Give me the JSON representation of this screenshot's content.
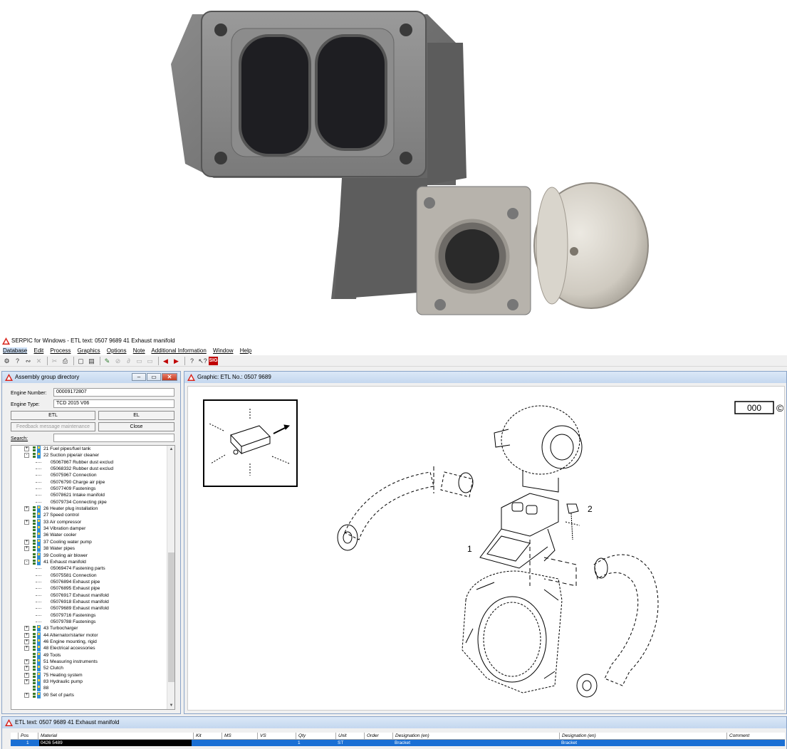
{
  "window": {
    "title": "SERPIC for Windows - ETL text: 0507 9689   41  Exhaust manifold"
  },
  "menu": [
    "Database",
    "Edit",
    "Process",
    "Graphics",
    "Options",
    "Note",
    "Additional Information",
    "Window",
    "Help"
  ],
  "toolbar_icons": [
    "engine-icon",
    "help-icon",
    "tool-icon",
    "close-icon",
    "cut-icon",
    "print-icon",
    "new-icon",
    "open-icon",
    "draw-icon",
    "link-icon",
    "link2-icon",
    "doc-icon",
    "doc2-icon",
    "back-arrow-icon",
    "forward-arrow-icon",
    "question-icon",
    "whats-this-icon",
    "sig-icon"
  ],
  "assembly": {
    "title": "Assembly group directory",
    "engine_number_label": "Engine Number:",
    "engine_number": "00009172807",
    "engine_type_label": "Engine Type:",
    "engine_type": "TCD 2015 V06",
    "etl_button": "ETL",
    "el_button": "EL",
    "feedback_button": "Feedback message maintenance",
    "close_button": "Close",
    "search_label": "Search:",
    "search_value": "",
    "tree": [
      {
        "type": "group",
        "label": "21  Fuel pipes/fuel tank",
        "expander": "+"
      },
      {
        "type": "group",
        "label": "22  Suction pipe/air cleaner",
        "expander": "-"
      },
      {
        "type": "child",
        "label": "05067867  Rubber dust exclud"
      },
      {
        "type": "child",
        "label": "05068332  Rubber dust exclud"
      },
      {
        "type": "child",
        "label": "05075967  Connection"
      },
      {
        "type": "child",
        "label": "05076790  Charge air pipe"
      },
      {
        "type": "child",
        "label": "05077409  Fastenings"
      },
      {
        "type": "child",
        "label": "05078621  Intake manifold"
      },
      {
        "type": "child",
        "label": "05079734  Connecting pipe"
      },
      {
        "type": "group",
        "label": "26  Heater plug installation",
        "expander": "+"
      },
      {
        "type": "group",
        "label": "27  Speed control",
        "expander": ""
      },
      {
        "type": "group",
        "label": "33  Air compressor",
        "expander": "+"
      },
      {
        "type": "group",
        "label": "34  Vibration damper",
        "expander": ""
      },
      {
        "type": "group",
        "label": "36  Water cooler",
        "expander": ""
      },
      {
        "type": "group",
        "label": "37  Cooling water pump",
        "expander": "+"
      },
      {
        "type": "group",
        "label": "38  Water pipes",
        "expander": "+"
      },
      {
        "type": "group",
        "label": "39  Cooling air blower",
        "expander": ""
      },
      {
        "type": "group",
        "label": "41  Exhaust manifold",
        "expander": "-"
      },
      {
        "type": "child",
        "label": "05069474  Fastening parts"
      },
      {
        "type": "child",
        "label": "05075581  Connection"
      },
      {
        "type": "child",
        "label": "05076894  Exhaust pipe"
      },
      {
        "type": "child",
        "label": "05076895  Exhaust pipe"
      },
      {
        "type": "child",
        "label": "05076917  Exhaust manifold"
      },
      {
        "type": "child",
        "label": "05076918  Exhaust manifold"
      },
      {
        "type": "child",
        "label": "05079689  Exhaust manifold"
      },
      {
        "type": "child",
        "label": "05079716  Fastenings"
      },
      {
        "type": "child",
        "label": "05079788  Fastenings"
      },
      {
        "type": "group",
        "label": "43  Turbocharger",
        "expander": "+"
      },
      {
        "type": "group",
        "label": "44  Alternator/starter motor",
        "expander": "+"
      },
      {
        "type": "group",
        "label": "46  Engine mounting, rigid",
        "expander": "+"
      },
      {
        "type": "group",
        "label": "48  Electrical accessories",
        "expander": "+"
      },
      {
        "type": "group",
        "label": "49  Tools",
        "expander": ""
      },
      {
        "type": "group",
        "label": "51  Measuring instruments",
        "expander": "+"
      },
      {
        "type": "group",
        "label": "52  Clutch",
        "expander": "+"
      },
      {
        "type": "group",
        "label": "75  Heating system",
        "expander": "+"
      },
      {
        "type": "group",
        "label": "83  Hydraulic pump",
        "expander": "+"
      },
      {
        "type": "group",
        "label": "88",
        "expander": ""
      },
      {
        "type": "group",
        "label": "90  Set of parts",
        "expander": "+"
      }
    ]
  },
  "graphic": {
    "title": "Graphic: ETL No.: 0507 9689",
    "code_box": "000",
    "copyright": "©",
    "callout_1": "1",
    "callout_2": "2"
  },
  "etl": {
    "title": "ETL text: 0507 9689   41  Exhaust manifold",
    "columns": [
      "Pos",
      "Material",
      "Kit",
      "MS",
      "VS",
      "Qty",
      "Unit",
      "Order",
      "Designation (en)",
      "Designation (en)",
      "Comment"
    ],
    "rows": [
      {
        "pos": "1",
        "material": "0426 5489",
        "kit": "",
        "ms": "",
        "vs": "",
        "qty": "1",
        "unit": "ST",
        "order": "",
        "designation_1": "Bracket",
        "designation_2": "Bracket",
        "comment": ""
      }
    ]
  }
}
